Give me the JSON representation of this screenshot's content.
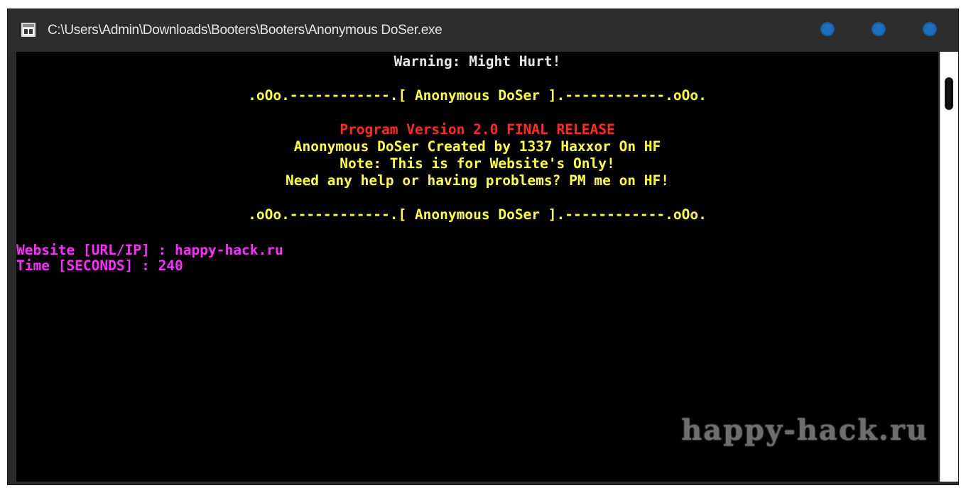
{
  "window": {
    "title": "C:\\Users\\Admin\\Downloads\\Booters\\Booters\\Anonymous DoSer.exe",
    "app_icon": "console-app-icon",
    "buttons": [
      {
        "name": "minimize-button",
        "color": "#1e6fbf"
      },
      {
        "name": "maximize-button",
        "color": "#1e6fbf"
      },
      {
        "name": "close-button",
        "color": "#1e6fbf"
      }
    ]
  },
  "console": {
    "background": "#000000",
    "lines": [
      {
        "text": "Warning: Might Hurt!",
        "color": "#e6e6e6",
        "align": "center"
      },
      {
        "text": ".oOo.------------.[ Anonymous DoSer ].------------.oOo.",
        "color": "#ffff3c",
        "align": "center"
      },
      {
        "text": "Program Version 2.0 FINAL RELEASE",
        "color": "#ff2a1e",
        "align": "center"
      },
      {
        "text": "Anonymous DoSer Created by 1337 Haxxor On HF",
        "color": "#ffff3c",
        "align": "center"
      },
      {
        "text": "Note: This is for Website's Only!",
        "color": "#ffff3c",
        "align": "center"
      },
      {
        "text": "Need any help or having problems? PM me on HF!",
        "color": "#ffff3c",
        "align": "center"
      },
      {
        "text": ".oOo.------------.[ Anonymous DoSer ].------------.oOo.",
        "color": "#ffff3c",
        "align": "center"
      },
      {
        "text": "Website [URL/IP] : happy-hack.ru",
        "color": "#ff2cff",
        "align": "left"
      },
      {
        "text": "Time [SECONDS] : 240",
        "color": "#ff2cff",
        "align": "left"
      }
    ]
  },
  "watermark": {
    "text": "happy-hack.ru"
  }
}
